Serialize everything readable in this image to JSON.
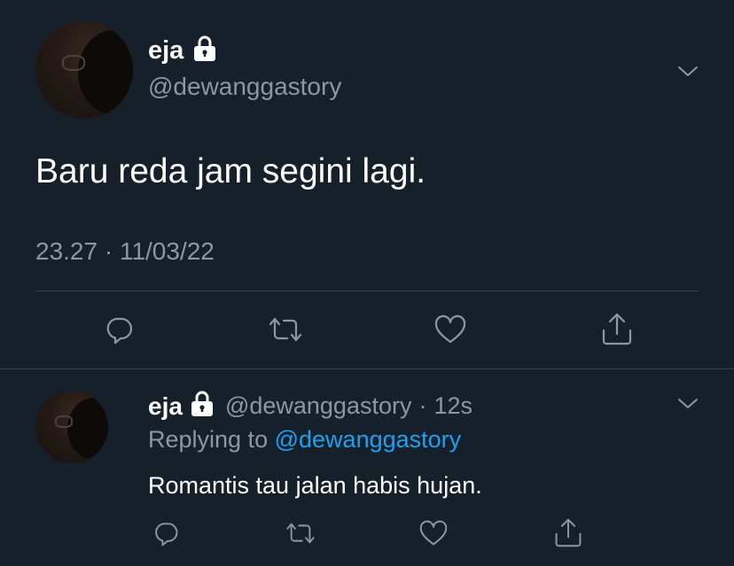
{
  "main_tweet": {
    "display_name": "eja",
    "handle": "@dewanggastory",
    "text": "Baru reda jam segini lagi.",
    "timestamp": "23.27 · 11/03/22",
    "icons": [
      "lock-icon",
      "chevron-down-icon",
      "reply-icon",
      "retweet-icon",
      "like-icon",
      "share-icon"
    ]
  },
  "reply_tweet": {
    "display_name": "eja",
    "handle": "@dewanggastory",
    "separator": "·",
    "age": "12s",
    "replying_prefix": "Replying to",
    "replying_handle": "@dewanggastory",
    "text": "Romantis tau jalan habis hujan.",
    "icons": [
      "lock-icon",
      "chevron-down-icon",
      "reply-icon",
      "retweet-icon",
      "like-icon",
      "share-icon"
    ]
  },
  "colors": {
    "background": "#15202b",
    "text_primary": "#ffffff",
    "text_muted": "#8899a6",
    "link": "#1da1f2",
    "divider": "#38444d"
  }
}
